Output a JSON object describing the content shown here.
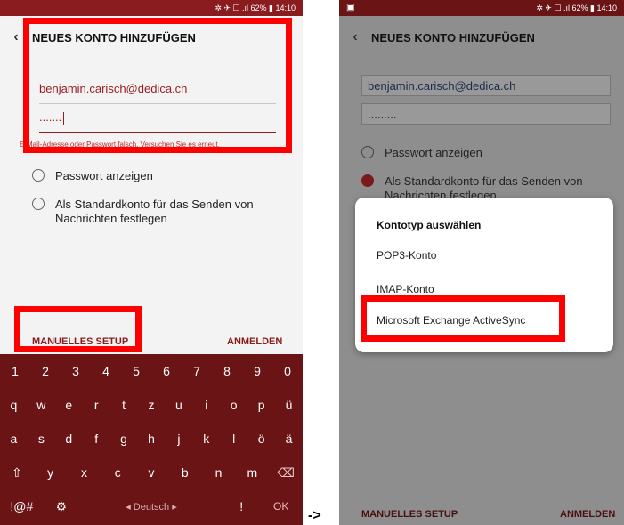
{
  "arrow": "->",
  "left": {
    "status": "✲ ✈ ☐ .ıl 62% ▮ 14:10",
    "title": "NEUES KONTO HINZUFÜGEN",
    "email": "benjamin.carisch@dedica.ch",
    "password_mask": ".......",
    "error": "E-Mail-Adresse oder Passwort falsch. Versuchen Sie es erneut.",
    "show_password": "Passwort anzeigen",
    "default_account": "Als Standardkonto für das Senden von Nachrichten festlegen",
    "manual_setup": "MANUELLES SETUP",
    "sign_in": "ANMELDEN",
    "keyboard": {
      "row1": [
        "1",
        "2",
        "3",
        "4",
        "5",
        "6",
        "7",
        "8",
        "9",
        "0"
      ],
      "row2": [
        "q",
        "w",
        "e",
        "r",
        "t",
        "z",
        "u",
        "i",
        "o",
        "p",
        "ü"
      ],
      "row3": [
        "a",
        "s",
        "d",
        "f",
        "g",
        "h",
        "j",
        "k",
        "l",
        "ö",
        "ä"
      ],
      "row4": [
        "⇧",
        "y",
        "x",
        "c",
        "v",
        "b",
        "n",
        "m",
        "⌫"
      ],
      "sym": "!@#",
      "settings": "⚙",
      "language": "◂ Deutsch ▸",
      "excl": "!",
      "ok": "OK"
    }
  },
  "right": {
    "status_left": "▣",
    "status": "✲ ✈ ☐ .ıl 62% ▮ 14:10",
    "title": "NEUES KONTO HINZUFÜGEN",
    "email": "benjamin.carisch@dedica.ch",
    "password_mask": ".........",
    "show_password": "Passwort anzeigen",
    "default_account": "Als Standardkonto für das Senden von Nachrichten festlegen",
    "dialog": {
      "title": "Kontotyp auswählen",
      "options": [
        "POP3-Konto",
        "IMAP-Konto",
        "Microsoft Exchange ActiveSync"
      ]
    },
    "manual_setup": "MANUELLES SETUP",
    "sign_in": "ANMELDEN"
  }
}
